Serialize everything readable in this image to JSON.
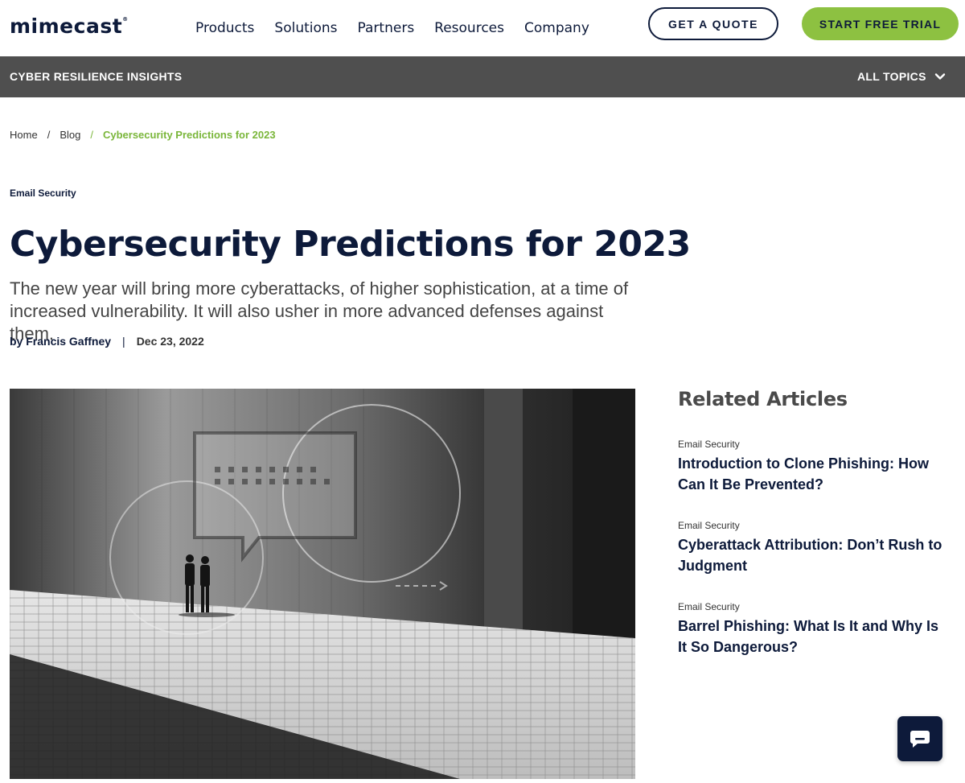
{
  "header": {
    "logo": "mimecast",
    "logo_mark": "®",
    "menu": [
      "Products",
      "Solutions",
      "Partners",
      "Resources",
      "Company"
    ],
    "quote_label": "GET A QUOTE",
    "trial_label": "START FREE TRIAL",
    "trial_color": "#8dc141",
    "brand_color": "#0d1a3a"
  },
  "subnav": {
    "title": "CYBER RESILIENCE INSIGHTS",
    "topics_label": "ALL TOPICS",
    "topics_icon": "chevron-down-icon"
  },
  "breadcrumb": {
    "items": [
      "Home",
      "Blog"
    ],
    "current": "Cybersecurity Predictions for 2023"
  },
  "article": {
    "category": "Email Security",
    "title": "Cybersecurity Predictions for 2023",
    "subtitle": "The new year will bring more cyberattacks, of higher sophistication, at a time of increased vulnerability. It will also usher in more advanced defenses against them.",
    "author": "by Francis Gaffney",
    "separator": "|",
    "date": "Dec 23, 2022"
  },
  "related": {
    "heading": "Related Articles",
    "items": [
      {
        "category": "Email Security",
        "title": "Introduction to Clone Phishing: How Can It Be Prevented?"
      },
      {
        "category": "Email Security",
        "title": "Cyberattack Attribution: Don’t Rush to Judgment"
      },
      {
        "category": "Email Security",
        "title": "Barrel Phishing: What Is It and Why Is It So Dangerous?"
      }
    ]
  },
  "chat": {
    "icon": "chat-bubble-icon"
  }
}
